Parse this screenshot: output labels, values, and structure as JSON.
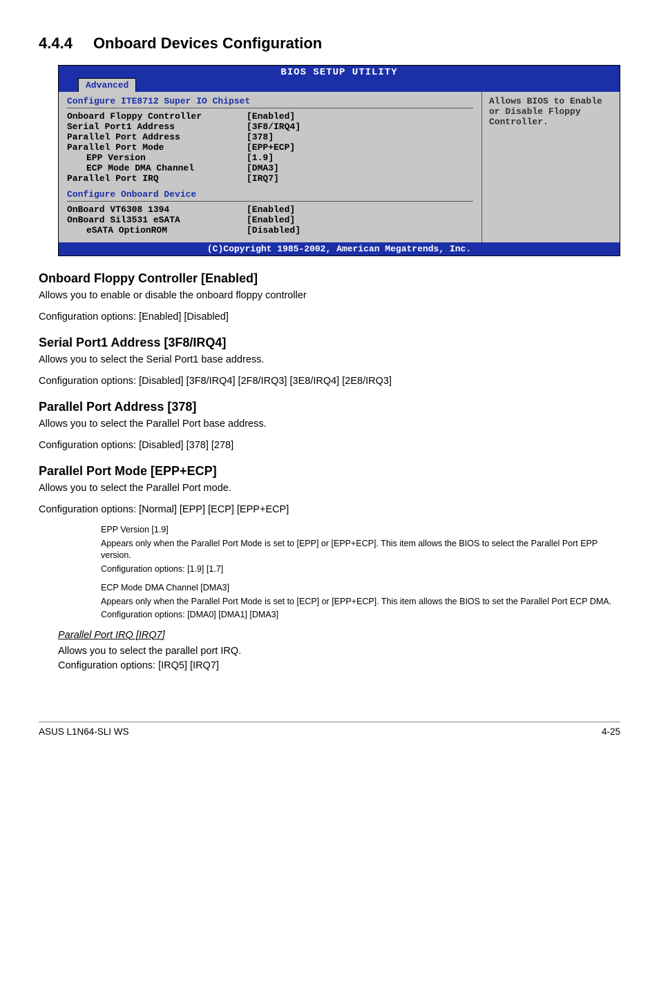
{
  "section": {
    "number": "4.4.4",
    "title": "Onboard Devices Configuration"
  },
  "bios": {
    "top_title": "BIOS SETUP UTILITY",
    "tab": "Advanced",
    "left_heading": "Configure ITE8712 Super IO Chipset",
    "items": [
      {
        "label": "Onboard Floppy Controller",
        "value": "[Enabled]",
        "indent": 0
      },
      {
        "label": "Serial Port1 Address",
        "value": "[3F8/IRQ4]",
        "indent": 0
      },
      {
        "label": "Parallel Port Address",
        "value": "[378]",
        "indent": 0
      },
      {
        "label": "Parallel Port Mode",
        "value": "[EPP+ECP]",
        "indent": 0
      },
      {
        "label": "EPP Version",
        "value": "[1.9]",
        "indent": 1
      },
      {
        "label": "ECP Mode DMA Channel",
        "value": "[DMA3]",
        "indent": 1
      },
      {
        "label": "Parallel Port IRQ",
        "value": "[IRQ7]",
        "indent": 0
      }
    ],
    "subheading": "Configure Onboard Device",
    "items2": [
      {
        "label": "OnBoard VT6308 1394",
        "value": "[Enabled]",
        "indent": 0
      },
      {
        "label": "OnBoard Sil3531 eSATA",
        "value": "[Enabled]",
        "indent": 0
      },
      {
        "label": "eSATA OptionROM",
        "value": "[Disabled]",
        "indent": 1
      }
    ],
    "right_text": "Allows BIOS to Enable or Disable Floppy Controller.",
    "footer": "(C)Copyright 1985-2002, American Megatrends, Inc."
  },
  "blocks": {
    "b1": {
      "title": "Onboard Floppy Controller [Enabled]",
      "l1": "Allows you to enable or disable the onboard floppy controller",
      "l2": "Configuration options: [Enabled] [Disabled]"
    },
    "b2": {
      "title": "Serial Port1 Address [3F8/IRQ4]",
      "l1": "Allows you to select the Serial Port1 base address.",
      "l2": "Configuration options: [Disabled] [3F8/IRQ4] [2F8/IRQ3] [3E8/IRQ4] [2E8/IRQ3]"
    },
    "b3": {
      "title": "Parallel Port Address [378]",
      "l1": "Allows you to select the Parallel Port base address.",
      "l2": "Configuration options: [Disabled] [378] [278]"
    },
    "b4": {
      "title": "Parallel Port Mode [EPP+ECP]",
      "l1": "Allows you to select the Parallel Port  mode.",
      "l2": "Configuration options: [Normal] [EPP] [ECP] [EPP+ECP]"
    },
    "s1": {
      "title": "EPP Version [1.9]",
      "l1": "Appears only when the Parallel Port Mode is set to [EPP] or [EPP+ECP]. This item allows the BIOS to select the Parallel Port EPP version.",
      "l2": "Configuration options: [1.9] [1.7]"
    },
    "s2": {
      "title": "ECP Mode DMA Channel [DMA3]",
      "l1": "Appears only when the Parallel Port Mode is set to [ECP] or [EPP+ECP]. This item allows the BIOS to set the Parallel Port ECP DMA.",
      "l2": "Configuration options: [DMA0] [DMA1] [DMA3]"
    },
    "s3": {
      "title": "Parallel Port IRQ [IRQ7]",
      "l1": "Allows you to select the parallel port IRQ.",
      "l2": "Configuration options: [IRQ5] [IRQ7]"
    }
  },
  "footer": {
    "left": "ASUS L1N64-SLI WS",
    "right": "4-25"
  }
}
